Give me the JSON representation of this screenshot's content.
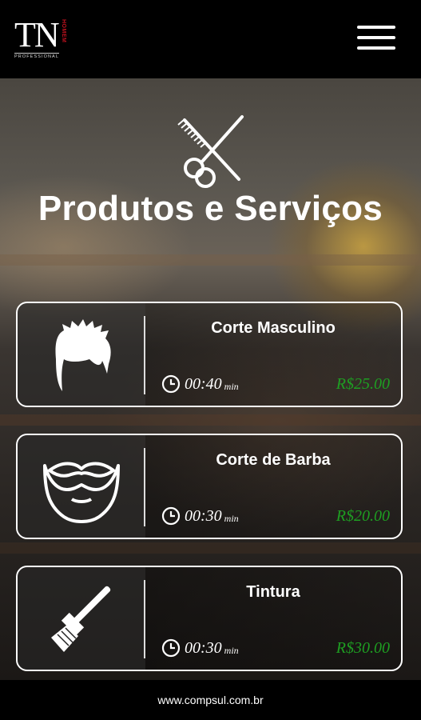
{
  "header": {
    "logo_text": "TN",
    "logo_side_text": "HOMEM",
    "logo_bottom_text": "PROFESSIONAL",
    "menu_icon": "hamburger-menu-icon"
  },
  "hero": {
    "icon": "comb-scissors-icon",
    "title": "Produtos e Serviços"
  },
  "services": [
    {
      "name": "Corte Masculino",
      "icon": "hair-icon",
      "duration": "00:40",
      "duration_unit": "min",
      "price": "R$25.00",
      "price_color": "#1e9e22"
    },
    {
      "name": "Corte de Barba",
      "icon": "beard-icon",
      "duration": "00:30",
      "duration_unit": "min",
      "price": "R$20.00",
      "price_color": "#1e9e22"
    },
    {
      "name": "Tintura",
      "icon": "dye-brush-icon",
      "duration": "00:30",
      "duration_unit": "min",
      "price": "R$30.00",
      "price_color": "#1e9e22"
    }
  ],
  "footer": {
    "text": "www.compsul.com.br"
  }
}
